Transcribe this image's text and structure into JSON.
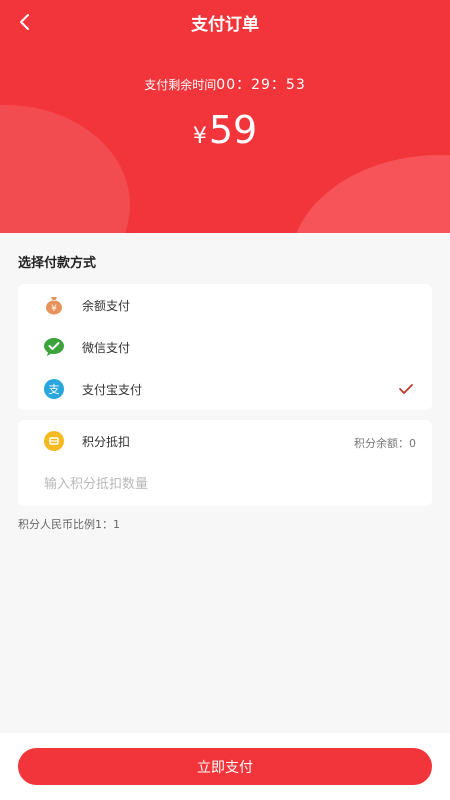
{
  "header": {
    "title": "支付订单",
    "countdown_label": "支付剩余时间",
    "countdown_value": "00：29：53",
    "currency": "¥",
    "amount": "59",
    "background_color": "#f2353a"
  },
  "payment": {
    "section_title": "选择付款方式",
    "methods": [
      {
        "label": "余额支付",
        "icon": "money-bag-icon",
        "color": "#e8935b",
        "selected": false
      },
      {
        "label": "微信支付",
        "icon": "wechat-icon",
        "color": "#3aa43a",
        "selected": false
      },
      {
        "label": "支付宝支付",
        "icon": "alipay-icon",
        "color": "#2aa6de",
        "selected": true
      }
    ],
    "check_color": "#c0392b"
  },
  "points": {
    "label": "积分抵扣",
    "balance_label": "积分余额：",
    "balance_value": "0",
    "input_placeholder": "输入积分抵扣数量",
    "input_value": "",
    "icon": "coin-icon",
    "ratio_text": "积分人民币比例1：1"
  },
  "footer": {
    "pay_button_label": "立即支付"
  }
}
